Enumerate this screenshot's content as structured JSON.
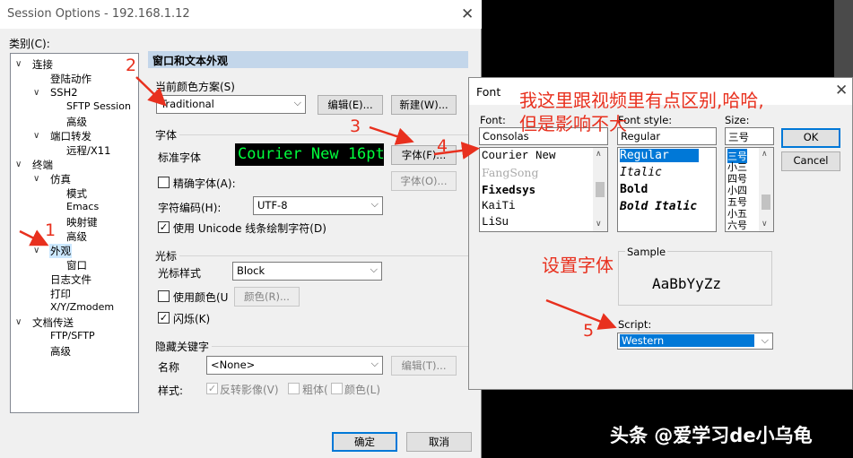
{
  "session_window": {
    "title": "Session Options - 192.168.1.12",
    "category_label": "类别(C):",
    "tree": [
      {
        "label": "连接",
        "toggle": "∨"
      },
      {
        "label": "登陆动作"
      },
      {
        "label": "SSH2",
        "toggle": "∨"
      },
      {
        "label": "SFTP Session"
      },
      {
        "label": "高级"
      },
      {
        "label": "端口转发",
        "toggle": "∨"
      },
      {
        "label": "远程/X11"
      },
      {
        "label": "终端",
        "toggle": "∨"
      },
      {
        "label": "仿真",
        "toggle": "∨"
      },
      {
        "label": "模式"
      },
      {
        "label": "Emacs"
      },
      {
        "label": "映射键"
      },
      {
        "label": "高级"
      },
      {
        "label": "外观",
        "toggle": "∨",
        "selected": true
      },
      {
        "label": "窗口"
      },
      {
        "label": "日志文件"
      },
      {
        "label": "打印"
      },
      {
        "label": "X/Y/Zmodem"
      },
      {
        "label": "文档传送",
        "toggle": "∨"
      },
      {
        "label": "FTP/SFTP"
      },
      {
        "label": "高级"
      }
    ],
    "panel_header": "窗口和文本外观",
    "color_scheme": {
      "label": "当前颜色方案(S)",
      "value": "Traditional",
      "edit_button": "编辑(E)...",
      "new_button": "新建(W)..."
    },
    "font": {
      "group": "字体",
      "std_label": "标准字体",
      "preview": "Courier New 16pt",
      "font_button": "字体(F)...",
      "precise_label": "精确字体(A):",
      "precise_button": "字体(O)...",
      "encoding_label": "字符编码(H):",
      "encoding_value": "UTF-8",
      "unicode_label": "使用 Unicode 线条绘制字符(D)"
    },
    "cursor": {
      "group": "光标",
      "style_label": "光标样式",
      "style_value": "Block",
      "use_color_label": "使用颜色(U",
      "color_button": "颜色(R)...",
      "blink_label": "闪烁(K)"
    },
    "keywords": {
      "group": "隐藏关键字",
      "name_label": "名称",
      "name_value": "<None>",
      "edit_button": "编辑(T)...",
      "style_label": "样式:",
      "reverse_label": "反转影像(V)",
      "bold_label": "粗体(",
      "color_label": "颜色(L)"
    },
    "ok_button": "确定",
    "cancel_button": "取消"
  },
  "font_dialog": {
    "title": "Font",
    "font_label": "Font:",
    "font_value": "Consolas",
    "fonts": [
      "Courier New",
      "FangSong",
      "Fixedsys",
      "KaiTi",
      "LiSu"
    ],
    "style_label": "Font style:",
    "style_value": "Regular",
    "styles": [
      "Regular",
      "Italic",
      "Bold",
      "Bold Italic"
    ],
    "size_label": "Size:",
    "size_value": "三号",
    "sizes": [
      "三号",
      "小三",
      "四号",
      "小四",
      "五号",
      "小五",
      "六号"
    ],
    "ok_button": "OK",
    "cancel_button": "Cancel",
    "sample_label": "Sample",
    "sample_text": "AaBbYyZz",
    "script_label": "Script:",
    "script_value": "Western"
  },
  "annotations": {
    "n1": "1",
    "n2": "2",
    "n3": "3",
    "n4": "4",
    "n5": "5",
    "note_line1": "我这里跟视频里有点区别,哈哈,",
    "note_line2": "但是影响不大",
    "set_font": "设置字体",
    "color": "#e8301e"
  },
  "watermark": "头条 @爱学习de小乌龟"
}
